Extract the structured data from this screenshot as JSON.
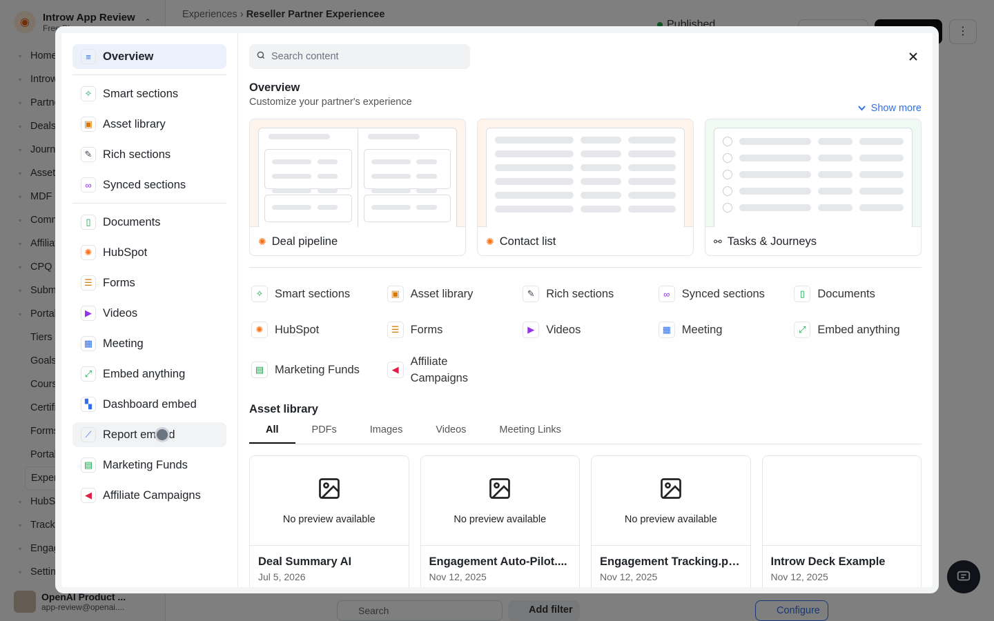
{
  "background": {
    "workspace": {
      "name": "Introw App Review",
      "plan": "Free Plan"
    },
    "nav": [
      {
        "label": "Home",
        "icon": "home-icon",
        "sub": false
      },
      {
        "label": "Introw",
        "icon": "sparkle-icon",
        "sub": false
      },
      {
        "label": "Partners",
        "icon": "handshake-icon",
        "sub": false
      },
      {
        "label": "Deals",
        "icon": "hubspot-icon",
        "sub": false
      },
      {
        "label": "Journeys",
        "icon": "journey-icon",
        "sub": false
      },
      {
        "label": "Assets",
        "icon": "folder-icon",
        "sub": false
      },
      {
        "label": "MDF",
        "icon": "coins-icon",
        "sub": false
      },
      {
        "label": "Commissions",
        "icon": "link-icon",
        "sub": false
      },
      {
        "label": "Affiliates",
        "icon": "megaphone-icon",
        "sub": false
      },
      {
        "label": "CPQ",
        "icon": "quote-icon",
        "sub": false
      },
      {
        "label": "Submissions",
        "icon": "inbox-icon",
        "sub": false
      },
      {
        "label": "Portal",
        "icon": "portal-icon",
        "sub": false
      },
      {
        "label": "Tiers",
        "icon": "",
        "sub": true
      },
      {
        "label": "Goals",
        "icon": "",
        "sub": true
      },
      {
        "label": "Courses",
        "icon": "",
        "sub": true
      },
      {
        "label": "Certificates",
        "icon": "",
        "sub": true
      },
      {
        "label": "Forms",
        "icon": "",
        "sub": true
      },
      {
        "label": "Portal",
        "icon": "",
        "sub": true
      },
      {
        "label": "Experiences",
        "icon": "",
        "sub": true,
        "active": true
      },
      {
        "label": "HubSpot",
        "icon": "hubspot-icon",
        "sub": false
      },
      {
        "label": "Tracking",
        "icon": "chart-icon",
        "sub": false
      },
      {
        "label": "Engagement",
        "icon": "megaphone-icon",
        "sub": false
      },
      {
        "label": "Settings",
        "icon": "gear-icon",
        "sub": false
      }
    ],
    "user": {
      "name": "OpenAI Product ...",
      "email": "app-review@openai...."
    },
    "breadcrumb": {
      "parent": "Experiences",
      "current": "Reseller Partner Experiencee"
    },
    "status": "Published",
    "search_placeholder": "Search",
    "add_filter": "Add filter",
    "configure": "Configure"
  },
  "modal": {
    "left": {
      "top": [
        {
          "label": "Overview",
          "icon": "list-icon",
          "glyph": "≡",
          "color": "#2f6fed"
        }
      ],
      "group1": [
        {
          "label": "Smart sections",
          "icon": "sparkle-icon",
          "glyph": "✧",
          "color": "#16a34a"
        },
        {
          "label": "Asset library",
          "icon": "bookmark-icon",
          "glyph": "▣",
          "color": "#d97706"
        },
        {
          "label": "Rich sections",
          "icon": "brush-icon",
          "glyph": "✎",
          "color": "#374151"
        },
        {
          "label": "Synced sections",
          "icon": "link-icon",
          "glyph": "∞",
          "color": "#9333ea"
        }
      ],
      "group2": [
        {
          "label": "Documents",
          "icon": "document-icon",
          "glyph": "▯",
          "color": "#16a34a"
        },
        {
          "label": "HubSpot",
          "icon": "hubspot-icon",
          "glyph": "✺",
          "color": "#f97316"
        },
        {
          "label": "Forms",
          "icon": "form-icon",
          "glyph": "☰",
          "color": "#d97706"
        },
        {
          "label": "Videos",
          "icon": "video-icon",
          "glyph": "▶",
          "color": "#9333ea"
        },
        {
          "label": "Meeting",
          "icon": "calendar-icon",
          "glyph": "▦",
          "color": "#2f6fed"
        },
        {
          "label": "Embed anything",
          "icon": "expand-icon",
          "glyph": "⤢",
          "color": "#16a34a"
        },
        {
          "label": "Dashboard embed",
          "icon": "dashboard-icon",
          "glyph": "▚",
          "color": "#2f6fed"
        },
        {
          "label": "Report embed",
          "icon": "chart-icon",
          "glyph": "⟋",
          "color": "#2f6fed",
          "hover": true
        },
        {
          "label": "Marketing Funds",
          "icon": "wallet-icon",
          "glyph": "▤",
          "color": "#16a34a"
        },
        {
          "label": "Affiliate Campaigns",
          "icon": "megaphone-icon",
          "glyph": "◀",
          "color": "#e11d48"
        }
      ]
    },
    "search": {
      "placeholder": "Search content"
    },
    "overview": {
      "title": "Overview",
      "subtitle": "Customize your partner's experience",
      "show_more": "Show more"
    },
    "cards": [
      {
        "label": "Deal pipeline",
        "icon": "hubspot-icon",
        "glyph": "✺",
        "color": "#f97316"
      },
      {
        "label": "Contact list",
        "icon": "hubspot-icon",
        "glyph": "✺",
        "color": "#f97316"
      },
      {
        "label": "Tasks & Journeys",
        "icon": "journey-icon",
        "glyph": "⚯",
        "color": "#333333"
      }
    ],
    "grid": [
      {
        "label": "Smart sections",
        "icon": "sparkle-icon",
        "glyph": "✧",
        "color": "#16a34a"
      },
      {
        "label": "Asset library",
        "icon": "bookmark-icon",
        "glyph": "▣",
        "color": "#d97706"
      },
      {
        "label": "Rich sections",
        "icon": "brush-icon",
        "glyph": "✎",
        "color": "#374151"
      },
      {
        "label": "Synced sections",
        "icon": "link-icon",
        "glyph": "∞",
        "color": "#9333ea"
      },
      {
        "label": "Documents",
        "icon": "document-icon",
        "glyph": "▯",
        "color": "#16a34a"
      },
      {
        "label": "HubSpot",
        "icon": "hubspot-icon",
        "glyph": "✺",
        "color": "#f97316"
      },
      {
        "label": "Forms",
        "icon": "form-icon",
        "glyph": "☰",
        "color": "#d97706"
      },
      {
        "label": "Videos",
        "icon": "video-icon",
        "glyph": "▶",
        "color": "#9333ea"
      },
      {
        "label": "Meeting",
        "icon": "calendar-icon",
        "glyph": "▦",
        "color": "#2f6fed"
      },
      {
        "label": "Embed anything",
        "icon": "expand-icon",
        "glyph": "⤢",
        "color": "#16a34a"
      },
      {
        "label": "Marketing Funds",
        "icon": "wallet-icon",
        "glyph": "▤",
        "color": "#16a34a"
      },
      {
        "label": "Affiliate Campaigns",
        "icon": "megaphone-icon",
        "glyph": "◀",
        "color": "#e11d48"
      }
    ],
    "asset_library": {
      "title": "Asset library",
      "tabs": [
        {
          "label": "All",
          "active": true
        },
        {
          "label": "PDFs"
        },
        {
          "label": "Images"
        },
        {
          "label": "Videos"
        },
        {
          "label": "Meeting Links"
        }
      ],
      "assets": [
        {
          "name": "Deal Summary AI",
          "date": "Jul 5, 2026",
          "preview": "No preview available"
        },
        {
          "name": "Engagement Auto-Pilot....",
          "date": "Nov 12, 2025",
          "preview": "No preview available"
        },
        {
          "name": "Engagement Tracking.png",
          "date": "Nov 12, 2025",
          "preview": "No preview available"
        },
        {
          "name": "Introw Deck Example",
          "date": "Nov 12, 2025",
          "preview": ""
        }
      ]
    }
  }
}
